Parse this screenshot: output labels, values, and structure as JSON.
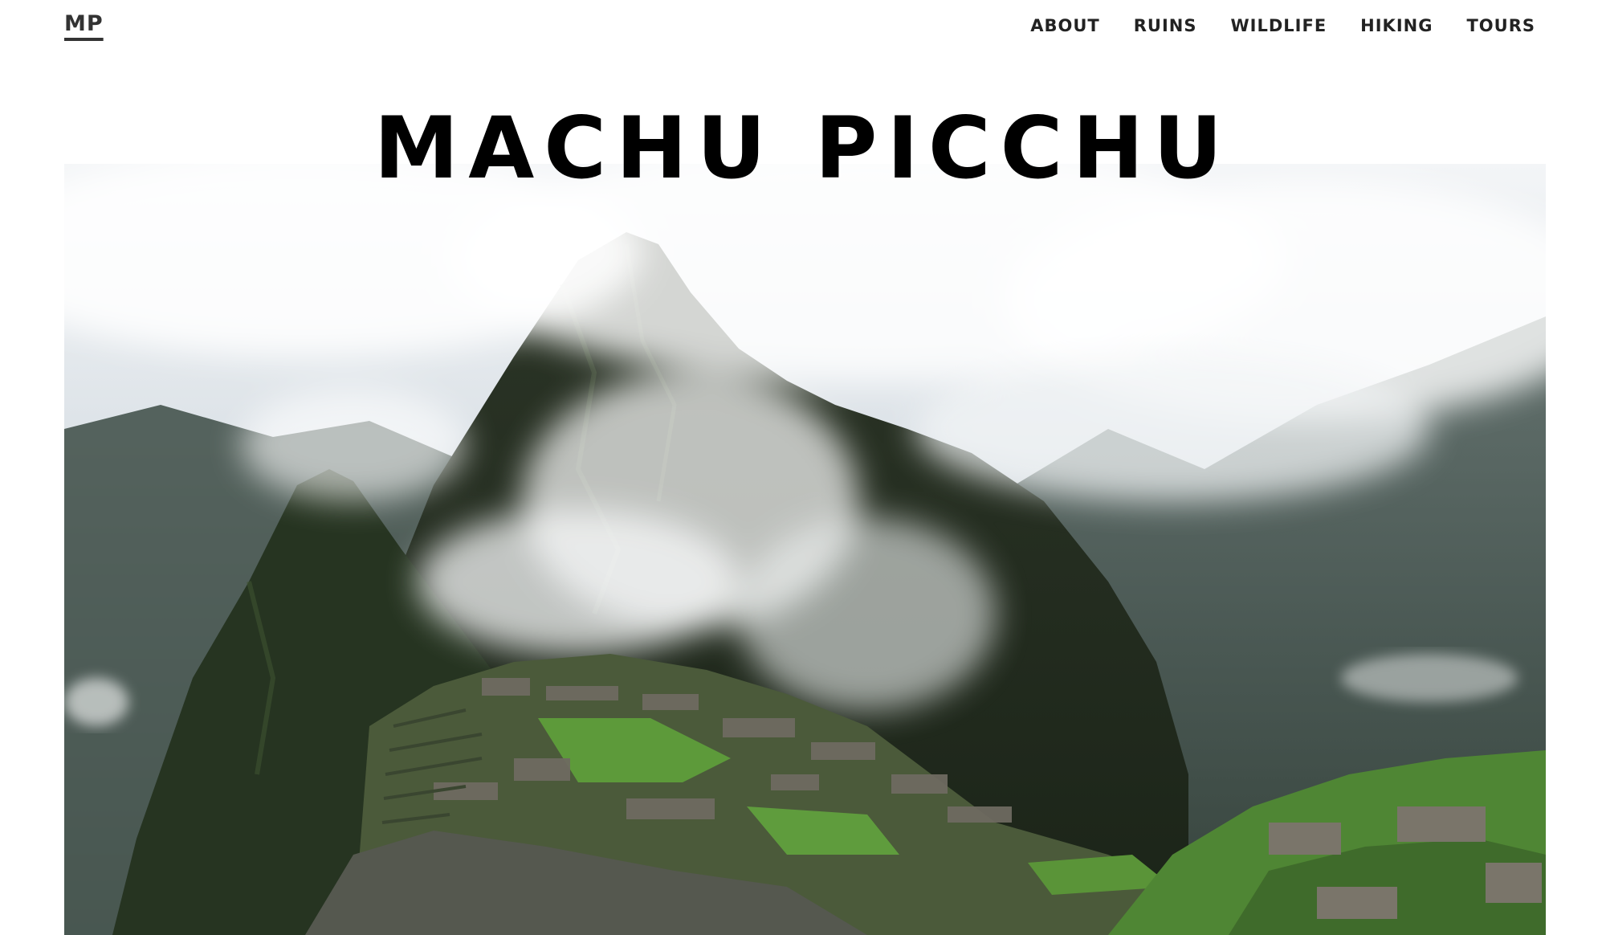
{
  "header": {
    "logo": "MP",
    "nav": [
      {
        "label": "ABOUT"
      },
      {
        "label": "RUINS"
      },
      {
        "label": "WILDLIFE"
      },
      {
        "label": "HIKING"
      },
      {
        "label": "TOURS"
      }
    ]
  },
  "hero": {
    "title": "MACHU PICCHU"
  },
  "colors": {
    "sky": "#e9edf0",
    "mountain_dark": "#23301f",
    "mountain_mid": "#3b4a33",
    "grass": "#5d9a3a",
    "stone": "#6e6a60"
  }
}
